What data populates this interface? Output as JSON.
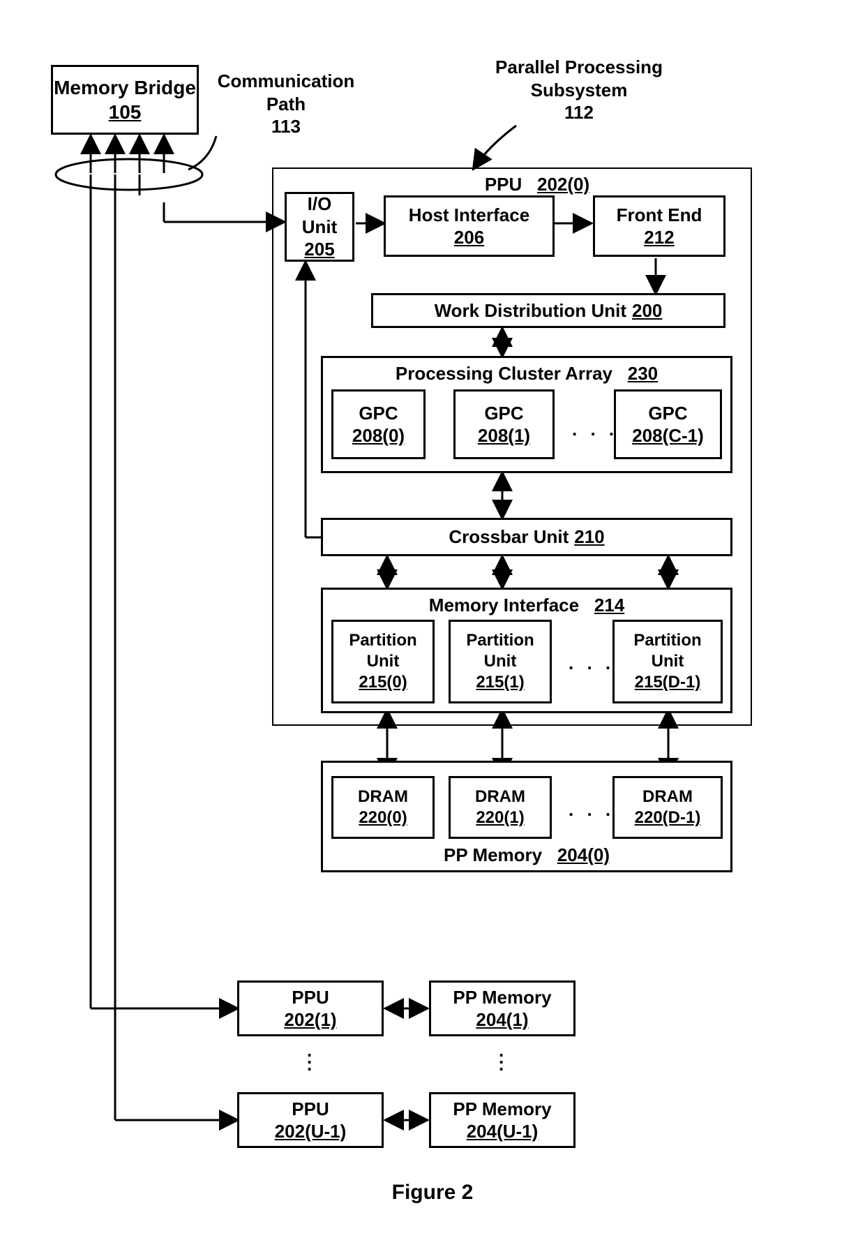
{
  "figure_caption": "Figure 2",
  "memory_bridge": {
    "title": "Memory Bridge",
    "ref": "105"
  },
  "comm_path": {
    "title": "Communication",
    "title2": "Path",
    "ref": "113"
  },
  "subsystem": {
    "title": "Parallel Processing",
    "title2": "Subsystem",
    "ref": "112"
  },
  "ppu0": {
    "title": "PPU",
    "ref": "202(0)"
  },
  "io_unit": {
    "l1": "I/O",
    "l2": "Unit",
    "ref": "205"
  },
  "host_if": {
    "title": "Host Interface",
    "ref": "206"
  },
  "front_end": {
    "title": "Front End",
    "ref": "212"
  },
  "work_dist": {
    "title": "Work Distribution Unit",
    "ref": "200"
  },
  "cluster_array": {
    "title": "Processing Cluster Array",
    "ref": "230"
  },
  "gpc0": {
    "title": "GPC",
    "ref": "208(0)"
  },
  "gpc1": {
    "title": "GPC",
    "ref": "208(1)"
  },
  "gpcc": {
    "title": "GPC",
    "ref": "208(C-1)"
  },
  "crossbar": {
    "title": "Crossbar Unit",
    "ref": "210"
  },
  "mem_if": {
    "title": "Memory Interface",
    "ref": "214"
  },
  "pu0": {
    "l1": "Partition",
    "l2": "Unit",
    "ref": "215(0)"
  },
  "pu1": {
    "l1": "Partition",
    "l2": "Unit",
    "ref": "215(1)"
  },
  "pud": {
    "l1": "Partition",
    "l2": "Unit",
    "ref": "215(D-1)"
  },
  "dram0": {
    "title": "DRAM",
    "ref": "220(0)"
  },
  "dram1": {
    "title": "DRAM",
    "ref": "220(1)"
  },
  "dramd": {
    "title": "DRAM",
    "ref": "220(D-1)"
  },
  "pp_mem0": {
    "title": "PP Memory",
    "ref": "204(0)"
  },
  "ppu1": {
    "title": "PPU",
    "ref": "202(1)"
  },
  "pp_mem1": {
    "title": "PP Memory",
    "ref": "204(1)"
  },
  "ppuu": {
    "title": "PPU",
    "ref": "202(U-1)"
  },
  "pp_memu": {
    "title": "PP Memory",
    "ref": "204(U-1)"
  }
}
